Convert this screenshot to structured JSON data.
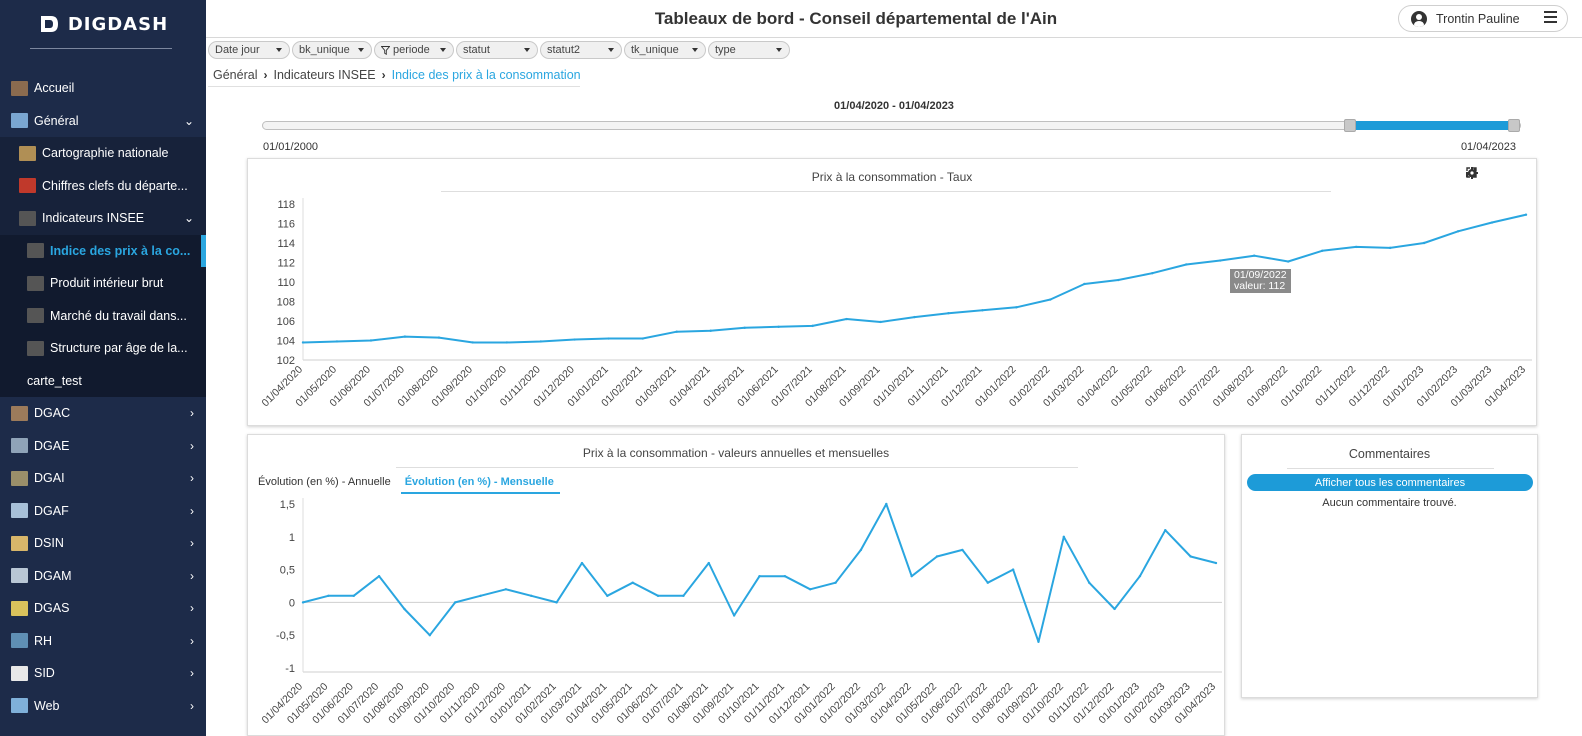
{
  "app": {
    "logo": "DIGDASH",
    "title": "Tableaux de bord - Conseil départemental de l'Ain",
    "user": "Trontin Pauline"
  },
  "sidebar": {
    "items": [
      {
        "label": "Accueil",
        "level": 0,
        "icon": "home-photo-icon",
        "color": "#8b6b4f",
        "chevron": ""
      },
      {
        "label": "Général",
        "level": 0,
        "icon": "chart-image-icon",
        "color": "#7aa6d1",
        "chevron": "⌄"
      },
      {
        "label": "Cartographie nationale",
        "level": 1,
        "icon": "map-image-icon",
        "color": "#b08f55",
        "chevron": ""
      },
      {
        "label": "Chiffres clefs du départe...",
        "level": 1,
        "icon": "keyfigures-image-icon",
        "color": "#c0392b",
        "chevron": ""
      },
      {
        "label": "Indicateurs INSEE",
        "level": 1,
        "icon": "insee-icon",
        "color": "#555555",
        "chevron": "⌄"
      },
      {
        "label": "Indice des prix à la co...",
        "level": 2,
        "icon": "insee-icon",
        "color": "#555555",
        "chevron": "",
        "active": true
      },
      {
        "label": "Produit intérieur brut",
        "level": 2,
        "icon": "insee-icon",
        "color": "#555555",
        "chevron": ""
      },
      {
        "label": "Marché du travail dans...",
        "level": 2,
        "icon": "insee-icon",
        "color": "#555555",
        "chevron": ""
      },
      {
        "label": "Structure par âge de la...",
        "level": 2,
        "icon": "insee-icon",
        "color": "#555555",
        "chevron": ""
      },
      {
        "label": "carte_test",
        "level": 2,
        "icon": "",
        "color": "",
        "chevron": ""
      },
      {
        "label": "DGAC",
        "level": 0,
        "icon": "dgac-icon",
        "color": "#9c7b5b",
        "chevron": "›"
      },
      {
        "label": "DGAE",
        "level": 0,
        "icon": "dgae-icon",
        "color": "#8fa3b8",
        "chevron": "›"
      },
      {
        "label": "DGAI",
        "level": 0,
        "icon": "dgai-icon",
        "color": "#9a8f6a",
        "chevron": "›"
      },
      {
        "label": "DGAF",
        "level": 0,
        "icon": "dgaf-icon",
        "color": "#a7c0d8",
        "chevron": "›"
      },
      {
        "label": "DSIN",
        "level": 0,
        "icon": "dsin-icon",
        "color": "#d8b66a",
        "chevron": "›"
      },
      {
        "label": "DGAM",
        "level": 0,
        "icon": "dgam-icon",
        "color": "#b9c7d5",
        "chevron": "›"
      },
      {
        "label": "DGAS",
        "level": 0,
        "icon": "dgas-icon",
        "color": "#d9c25c",
        "chevron": "›"
      },
      {
        "label": "RH",
        "level": 0,
        "icon": "rh-icon",
        "color": "#5f8fb4",
        "chevron": "›"
      },
      {
        "label": "SID",
        "level": 0,
        "icon": "sid-icon",
        "color": "#e8e8e8",
        "chevron": "›"
      },
      {
        "label": "Web",
        "level": 0,
        "icon": "web-icon",
        "color": "#7fb0d9",
        "chevron": "›"
      }
    ]
  },
  "filters": [
    {
      "label": "Date jour",
      "icon": ""
    },
    {
      "label": "bk_unique",
      "icon": ""
    },
    {
      "label": "periode",
      "icon": "filter"
    },
    {
      "label": "statut",
      "icon": ""
    },
    {
      "label": "statut2",
      "icon": ""
    },
    {
      "label": "tk_unique",
      "icon": ""
    },
    {
      "label": "type",
      "icon": ""
    }
  ],
  "breadcrumb": [
    "Général",
    "Indicateurs INSEE",
    "Indice des prix à la consommation"
  ],
  "range": {
    "label": "01/04/2020 - 01/04/2023",
    "min": "01/01/2000",
    "max": "01/04/2023",
    "selected_start_fraction": 0.865,
    "selected_end_fraction": 1.0
  },
  "chart1": {
    "title": "Prix à la consommation - Taux",
    "tooltip_date": "01/09/2022",
    "tooltip_value": "valeur: 112"
  },
  "chart2": {
    "title": "Prix à la consommation - valeurs annuelles et mensuelles",
    "tabs": [
      "Évolution (en %) - Annuelle",
      "Évolution (en %) - Mensuelle"
    ],
    "active_tab": 1
  },
  "comments": {
    "title": "Commentaires",
    "button": "Afficher tous les commentaires",
    "empty": "Aucun commentaire trouvé."
  },
  "colors": {
    "accent": "#2aa6e0",
    "line": "#2aa6e0",
    "sidebar": "#1d2b49"
  },
  "chart_data": [
    {
      "type": "line",
      "title": "Prix à la consommation - Taux",
      "x": [
        "01/04/2020",
        "01/05/2020",
        "01/06/2020",
        "01/07/2020",
        "01/08/2020",
        "01/09/2020",
        "01/10/2020",
        "01/11/2020",
        "01/12/2020",
        "01/01/2021",
        "01/02/2021",
        "01/03/2021",
        "01/04/2021",
        "01/05/2021",
        "01/06/2021",
        "01/07/2021",
        "01/08/2021",
        "01/09/2021",
        "01/10/2021",
        "01/11/2021",
        "01/12/2021",
        "01/01/2022",
        "01/02/2022",
        "01/03/2022",
        "01/04/2022",
        "01/05/2022",
        "01/06/2022",
        "01/07/2022",
        "01/08/2022",
        "01/09/2022",
        "01/10/2022",
        "01/11/2022",
        "01/12/2022",
        "01/01/2023",
        "01/02/2023",
        "01/03/2023",
        "01/04/2023"
      ],
      "series": [
        {
          "values": [
            103.8,
            103.9,
            104.0,
            104.4,
            104.3,
            103.8,
            103.8,
            103.9,
            104.1,
            104.2,
            104.2,
            104.9,
            105.0,
            105.3,
            105.4,
            105.5,
            106.2,
            105.9,
            106.4,
            106.8,
            107.1,
            107.4,
            108.2,
            109.8,
            110.2,
            110.9,
            111.8,
            112.2,
            112.7,
            112.1,
            113.2,
            113.6,
            113.5,
            114.0,
            115.2,
            116.1,
            116.9
          ]
        }
      ],
      "ylim": [
        102,
        118
      ],
      "yticks": [
        102,
        104,
        106,
        108,
        110,
        112,
        114,
        116,
        118
      ],
      "grid": false
    },
    {
      "type": "line",
      "title": "Prix à la consommation - valeurs annuelles et mensuelles",
      "x": [
        "01/04/2020",
        "01/05/2020",
        "01/06/2020",
        "01/07/2020",
        "01/08/2020",
        "01/09/2020",
        "01/10/2020",
        "01/11/2020",
        "01/12/2020",
        "01/01/2021",
        "01/02/2021",
        "01/03/2021",
        "01/04/2021",
        "01/05/2021",
        "01/06/2021",
        "01/07/2021",
        "01/08/2021",
        "01/09/2021",
        "01/10/2021",
        "01/11/2021",
        "01/12/2021",
        "01/01/2022",
        "01/02/2022",
        "01/03/2022",
        "01/04/2022",
        "01/05/2022",
        "01/06/2022",
        "01/07/2022",
        "01/08/2022",
        "01/09/2022",
        "01/10/2022",
        "01/11/2022",
        "01/12/2022",
        "01/01/2023",
        "01/02/2023",
        "01/03/2023",
        "01/04/2023"
      ],
      "series": [
        {
          "values": [
            0.0,
            0.1,
            0.1,
            0.4,
            -0.1,
            -0.5,
            0.0,
            0.1,
            0.2,
            0.1,
            0.0,
            0.6,
            0.1,
            0.3,
            0.1,
            0.1,
            0.6,
            -0.2,
            0.4,
            0.4,
            0.2,
            0.3,
            0.8,
            1.5,
            0.4,
            0.7,
            0.8,
            0.3,
            0.5,
            -0.6,
            1.0,
            0.3,
            -0.1,
            0.4,
            1.1,
            0.7,
            0.6
          ]
        }
      ],
      "ylim": [
        -1,
        1.5
      ],
      "yticks": [
        -1,
        -0.5,
        0,
        0.5,
        1,
        1.5
      ],
      "ytick_labels": [
        "-1",
        "-0,5",
        "0",
        "0,5",
        "1",
        "1,5"
      ],
      "grid": false
    }
  ]
}
